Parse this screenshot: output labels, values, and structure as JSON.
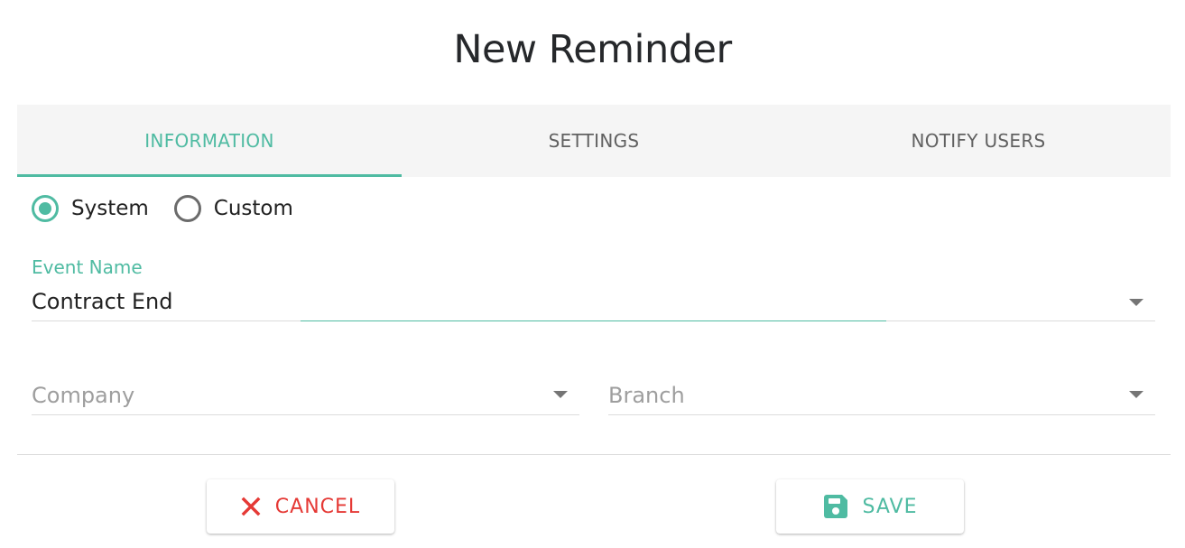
{
  "dialog": {
    "title": "New Reminder"
  },
  "tabs": [
    {
      "label": "INFORMATION",
      "active": true
    },
    {
      "label": "SETTINGS",
      "active": false
    },
    {
      "label": "NOTIFY USERS",
      "active": false
    }
  ],
  "reminder_type": {
    "options": [
      {
        "label": "System",
        "checked": true
      },
      {
        "label": "Custom",
        "checked": false
      }
    ]
  },
  "event_name": {
    "label": "Event Name",
    "value": "Contract End"
  },
  "company": {
    "placeholder": "Company"
  },
  "branch": {
    "placeholder": "Branch"
  },
  "actions": {
    "cancel_label": "CANCEL",
    "cancel_icon": "close-icon",
    "save_label": "SAVE",
    "save_icon": "save-icon"
  },
  "colors": {
    "accent": "#4fbba2",
    "danger": "#e53935",
    "tab_bar_bg": "#f5f5f5"
  }
}
